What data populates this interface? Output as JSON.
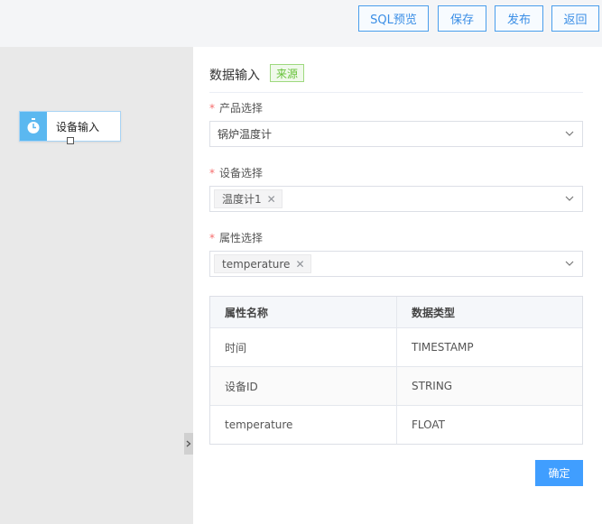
{
  "toolbar": {
    "sql_preview": "SQL预览",
    "save": "保存",
    "publish": "发布",
    "back": "返回"
  },
  "canvas": {
    "node_label": "设备输入",
    "node_icon": "stopwatch-icon"
  },
  "panel": {
    "title": "数据输入",
    "tag": "来源",
    "product": {
      "label": "产品选择",
      "value": "锅炉温度计"
    },
    "device": {
      "label": "设备选择",
      "chips": [
        "温度计1"
      ]
    },
    "attribute": {
      "label": "属性选择",
      "chips": [
        "temperature"
      ]
    },
    "table": {
      "headers": [
        "属性名称",
        "数据类型"
      ],
      "rows": [
        [
          "时间",
          "TIMESTAMP"
        ],
        [
          "设备ID",
          "STRING"
        ],
        [
          "temperature",
          "FLOAT"
        ]
      ]
    },
    "confirm": "确定"
  },
  "colors": {
    "primary": "#409eff",
    "tag_green": "#67c23a",
    "required": "#f56c6c",
    "node_icon_bg": "#5bb8f0"
  }
}
